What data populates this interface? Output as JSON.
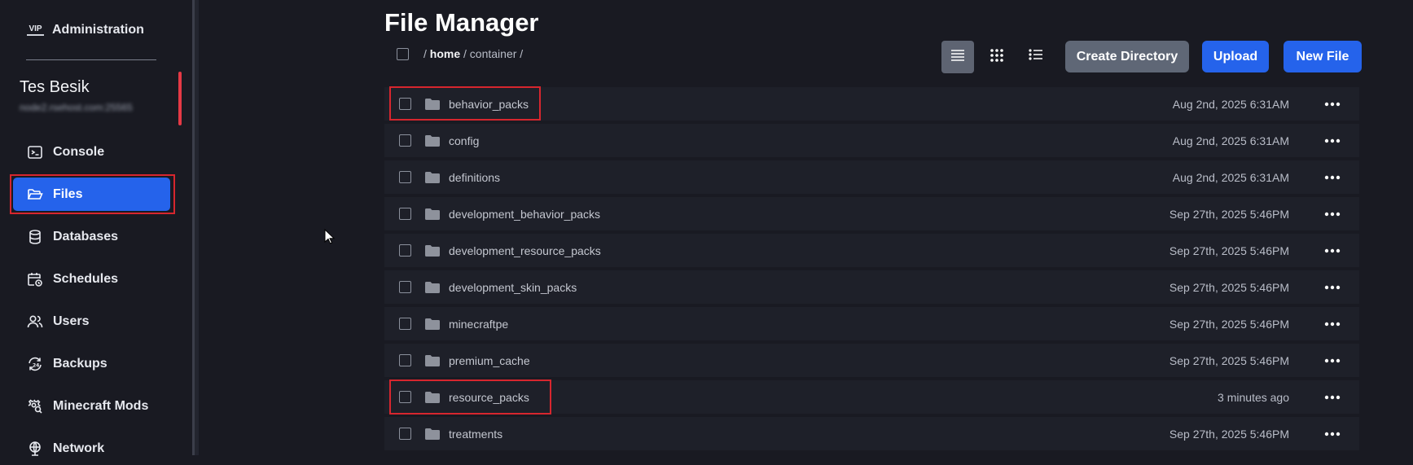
{
  "sidebar": {
    "admin_label": "Administration",
    "admin_icon": "VIP",
    "server_name": "Tes Besik",
    "server_host": "node2.rsehost.com:25565",
    "items": [
      {
        "label": "Console",
        "icon": "terminal-icon"
      },
      {
        "label": "Files",
        "icon": "folder-open-icon",
        "active": true
      },
      {
        "label": "Databases",
        "icon": "database-icon"
      },
      {
        "label": "Schedules",
        "icon": "calendar-clock-icon"
      },
      {
        "label": "Users",
        "icon": "users-icon"
      },
      {
        "label": "Backups",
        "icon": "backup-24-icon"
      },
      {
        "label": "Minecraft Mods",
        "icon": "gear-search-icon"
      },
      {
        "label": "Network",
        "icon": "globe-icon"
      }
    ]
  },
  "main": {
    "title": "File Manager",
    "breadcrumb": {
      "separator": "/",
      "home": "home",
      "current": "container"
    },
    "toolbar": {
      "create_dir_label": "Create Directory",
      "upload_label": "Upload",
      "new_file_label": "New File"
    },
    "files": [
      {
        "name": "behavior_packs",
        "modified": "Aug 2nd, 2025 6:31AM"
      },
      {
        "name": "config",
        "modified": "Aug 2nd, 2025 6:31AM"
      },
      {
        "name": "definitions",
        "modified": "Aug 2nd, 2025 6:31AM"
      },
      {
        "name": "development_behavior_packs",
        "modified": "Sep 27th, 2025 5:46PM"
      },
      {
        "name": "development_resource_packs",
        "modified": "Sep 27th, 2025 5:46PM"
      },
      {
        "name": "development_skin_packs",
        "modified": "Sep 27th, 2025 5:46PM"
      },
      {
        "name": "minecraftpe",
        "modified": "Sep 27th, 2025 5:46PM"
      },
      {
        "name": "premium_cache",
        "modified": "Sep 27th, 2025 5:46PM"
      },
      {
        "name": "resource_packs",
        "modified": "3 minutes ago"
      },
      {
        "name": "treatments",
        "modified": "Sep 27th, 2025 5:46PM"
      }
    ]
  },
  "colors": {
    "accent_blue": "#2563eb",
    "highlight_red": "#d7262e",
    "server_accent": "#e53945"
  }
}
